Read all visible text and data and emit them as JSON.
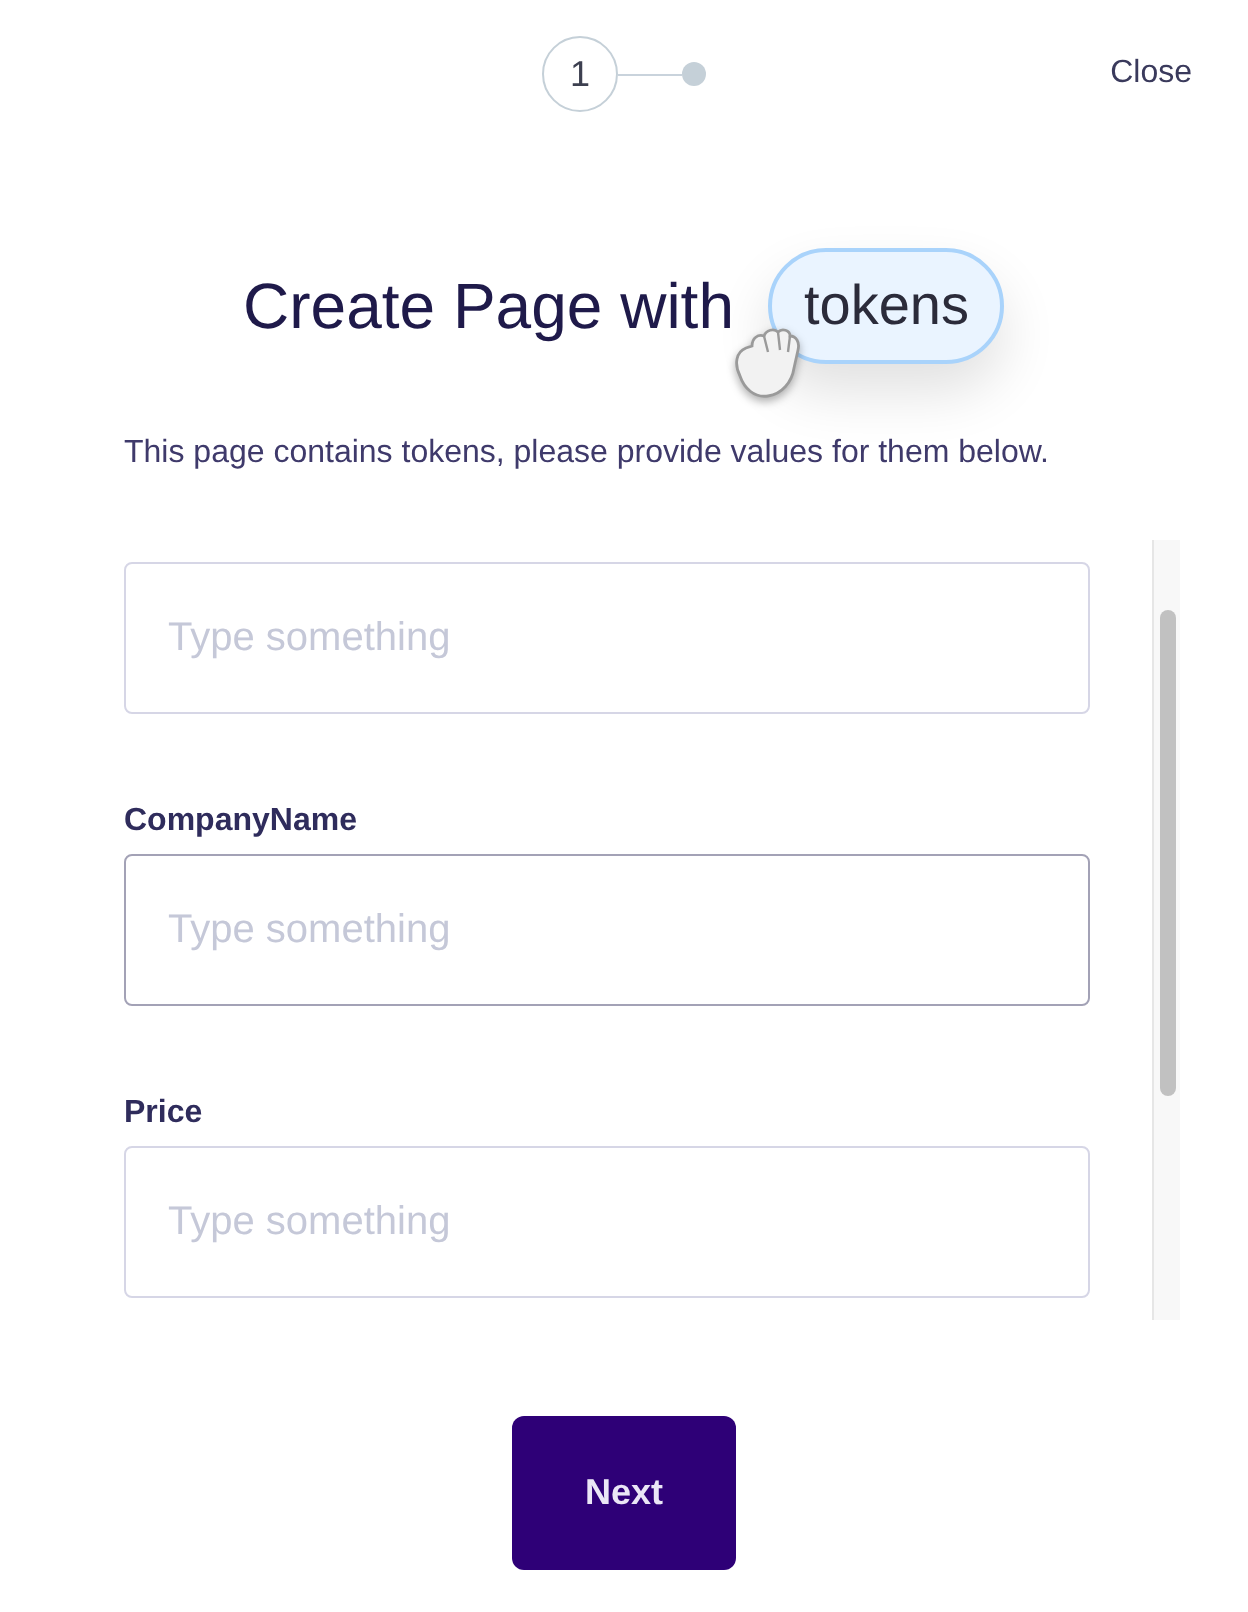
{
  "stepper": {
    "steps": [
      {
        "label": "1",
        "selected": true
      },
      {
        "selected": false
      }
    ]
  },
  "close_link": "Close",
  "title": {
    "text": "Create Page with",
    "token": "tokens"
  },
  "subtitle": "This page contains tokens, please provide values for them below.",
  "fields": [
    {
      "placeholder": "Type something",
      "focused": false
    },
    {
      "label": "CompanyName",
      "placeholder": "Type something",
      "focused": true
    },
    {
      "label": "Price",
      "placeholder": "Type something",
      "focused": false
    }
  ],
  "next_button": "Next"
}
